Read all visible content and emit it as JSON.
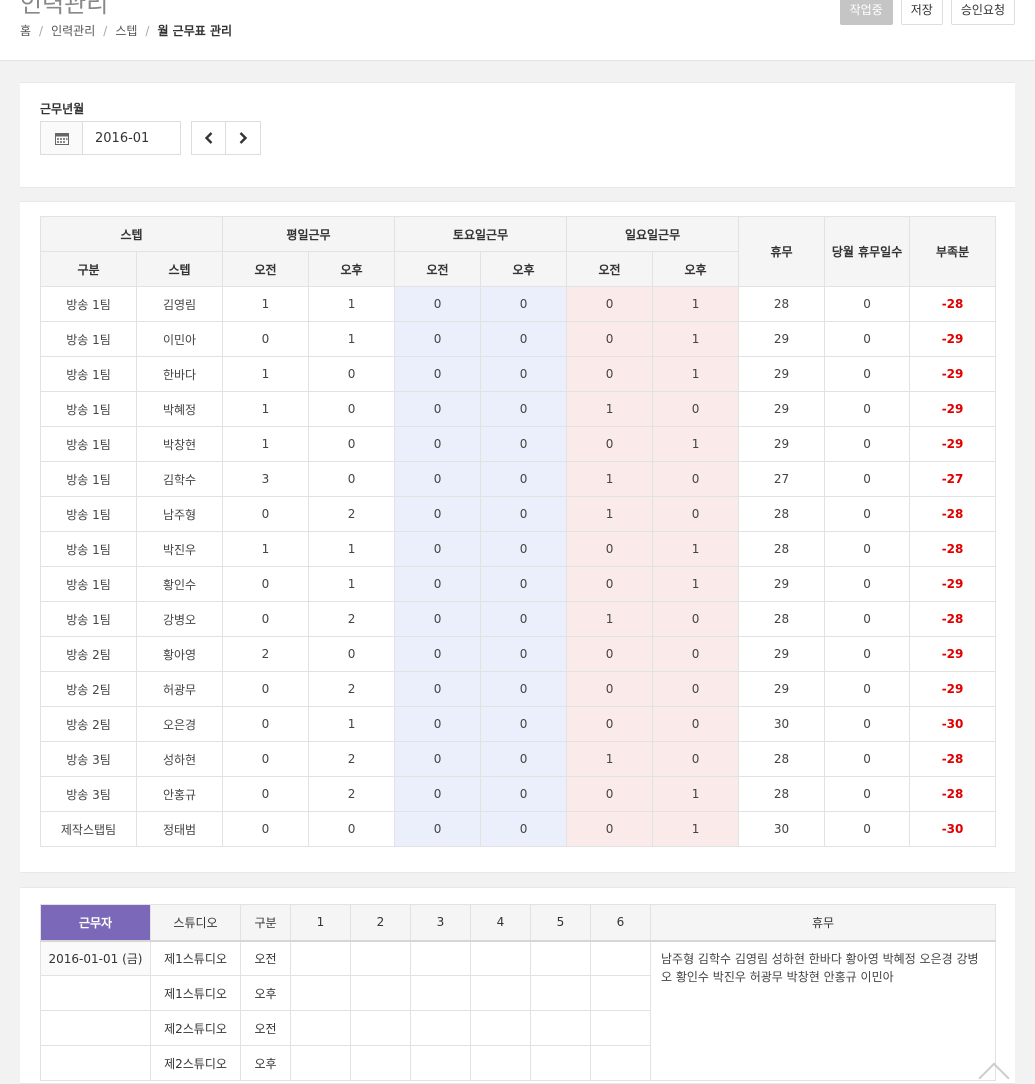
{
  "header": {
    "page_title": "인력관리",
    "breadcrumb": [
      "홈",
      "인력관리",
      "스텝",
      "월 근무표 관리"
    ],
    "buttons": {
      "working": "작업중",
      "save": "저장",
      "approve": "승인요청"
    }
  },
  "filter": {
    "label": "근무년월",
    "value": "2016-01"
  },
  "summary": {
    "group_headers": {
      "staff": "스텝",
      "weekday": "평일근무",
      "saturday": "토요일근무",
      "sunday": "일요일근무",
      "off": "휴무",
      "monthly_off": "당월 휴무일수",
      "shortage": "부족분"
    },
    "sub_headers": {
      "team": "구분",
      "staff": "스텝",
      "am": "오전",
      "pm": "오후"
    },
    "rows": [
      [
        "방송 1팀",
        "김영림",
        "1",
        "1",
        "0",
        "0",
        "0",
        "1",
        "28",
        "0",
        "-28"
      ],
      [
        "방송 1팀",
        "이민아",
        "0",
        "1",
        "0",
        "0",
        "0",
        "1",
        "29",
        "0",
        "-29"
      ],
      [
        "방송 1팀",
        "한바다",
        "1",
        "0",
        "0",
        "0",
        "0",
        "1",
        "29",
        "0",
        "-29"
      ],
      [
        "방송 1팀",
        "박혜정",
        "1",
        "0",
        "0",
        "0",
        "1",
        "0",
        "29",
        "0",
        "-29"
      ],
      [
        "방송 1팀",
        "박창현",
        "1",
        "0",
        "0",
        "0",
        "0",
        "1",
        "29",
        "0",
        "-29"
      ],
      [
        "방송 1팀",
        "김학수",
        "3",
        "0",
        "0",
        "0",
        "1",
        "0",
        "27",
        "0",
        "-27"
      ],
      [
        "방송 1팀",
        "남주형",
        "0",
        "2",
        "0",
        "0",
        "1",
        "0",
        "28",
        "0",
        "-28"
      ],
      [
        "방송 1팀",
        "박진우",
        "1",
        "1",
        "0",
        "0",
        "0",
        "1",
        "28",
        "0",
        "-28"
      ],
      [
        "방송 1팀",
        "황인수",
        "0",
        "1",
        "0",
        "0",
        "0",
        "1",
        "29",
        "0",
        "-29"
      ],
      [
        "방송 1팀",
        "강병오",
        "0",
        "2",
        "0",
        "0",
        "1",
        "0",
        "28",
        "0",
        "-28"
      ],
      [
        "방송 2팀",
        "황아영",
        "2",
        "0",
        "0",
        "0",
        "0",
        "0",
        "29",
        "0",
        "-29"
      ],
      [
        "방송 2팀",
        "허광무",
        "0",
        "2",
        "0",
        "0",
        "0",
        "0",
        "29",
        "0",
        "-29"
      ],
      [
        "방송 2팀",
        "오은경",
        "0",
        "1",
        "0",
        "0",
        "0",
        "0",
        "30",
        "0",
        "-30"
      ],
      [
        "방송 3팀",
        "성하현",
        "0",
        "2",
        "0",
        "0",
        "1",
        "0",
        "28",
        "0",
        "-28"
      ],
      [
        "방송 3팀",
        "안홍규",
        "0",
        "2",
        "0",
        "0",
        "0",
        "1",
        "28",
        "0",
        "-28"
      ],
      [
        "제작스탭팀",
        "정태범",
        "0",
        "0",
        "0",
        "0",
        "0",
        "1",
        "30",
        "0",
        "-30"
      ]
    ],
    "colors": {
      "saturday_bg": "#ebeefb",
      "sunday_bg": "#fbeaea",
      "shortage_text": "#e00000"
    }
  },
  "schedule": {
    "headers": [
      "근무자",
      "스튜디오",
      "구분",
      "1",
      "2",
      "3",
      "4",
      "5",
      "6",
      "휴무"
    ],
    "date": "2016-01-01 (금)",
    "rows": [
      {
        "studio": "제1스튜디오",
        "shift": "오전"
      },
      {
        "studio": "제1스튜디오",
        "shift": "오후"
      },
      {
        "studio": "제2스튜디오",
        "shift": "오전"
      },
      {
        "studio": "제2스튜디오",
        "shift": "오후"
      }
    ],
    "rest_names": "남주형 김학수 김영림 성하현 한바다 황아영 박혜정 오은경 강병오 황인수 박진우 허광무 박창현 안홍규 이민아",
    "accent": "#7b68b8"
  },
  "icons": {
    "calendar": "calendar-icon",
    "prev": "chevron-left-icon",
    "next": "chevron-right-icon"
  }
}
